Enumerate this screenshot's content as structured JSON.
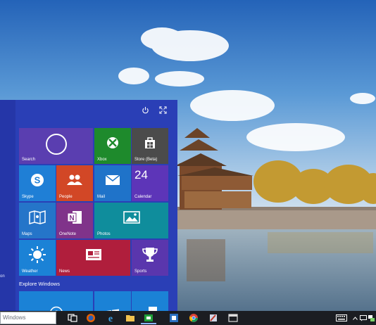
{
  "wallpaper": {
    "sky_top": "#2b6fc4",
    "sky_bottom": "#9fc3e6",
    "water": "#6f8fa6",
    "wall": "#a9998a",
    "trees": "#c8a23a"
  },
  "start_menu": {
    "side_label": "on",
    "section_heading": "Explore Windows",
    "tiles": {
      "search": {
        "label": "Search",
        "color": "#5a3eb0"
      },
      "xbox": {
        "label": "Xbox",
        "color": "#1e8a2c"
      },
      "store": {
        "label": "Store (Beta)",
        "color": "#4b4b4b"
      },
      "skype": {
        "label": "Skype",
        "color": "#1f7fd6"
      },
      "people": {
        "label": "People",
        "color": "#d24726"
      },
      "mail": {
        "label": "Mail",
        "color": "#1f73c9"
      },
      "calendar": {
        "label": "Calendar",
        "color": "#5d35b8",
        "number": "24"
      },
      "maps": {
        "label": "Maps",
        "color": "#2575c9"
      },
      "onenote": {
        "label": "OneNote",
        "color": "#80338a"
      },
      "photos": {
        "label": "Photos",
        "color": "#0f8d9c"
      },
      "weather": {
        "label": "Weather",
        "color": "#1b82d6"
      },
      "news": {
        "label": "News",
        "color": "#b01e3c"
      },
      "sports": {
        "label": "Sports",
        "color": "#5a36ad"
      }
    }
  },
  "taskbar": {
    "search_placeholder": "Windows",
    "apps": [
      "task-view",
      "firefox",
      "internet-explorer",
      "file-explorer",
      "store",
      "windows-app",
      "chrome",
      "paint",
      "window"
    ],
    "tray": [
      "keyboard",
      "chevron-up",
      "message",
      "network"
    ]
  }
}
